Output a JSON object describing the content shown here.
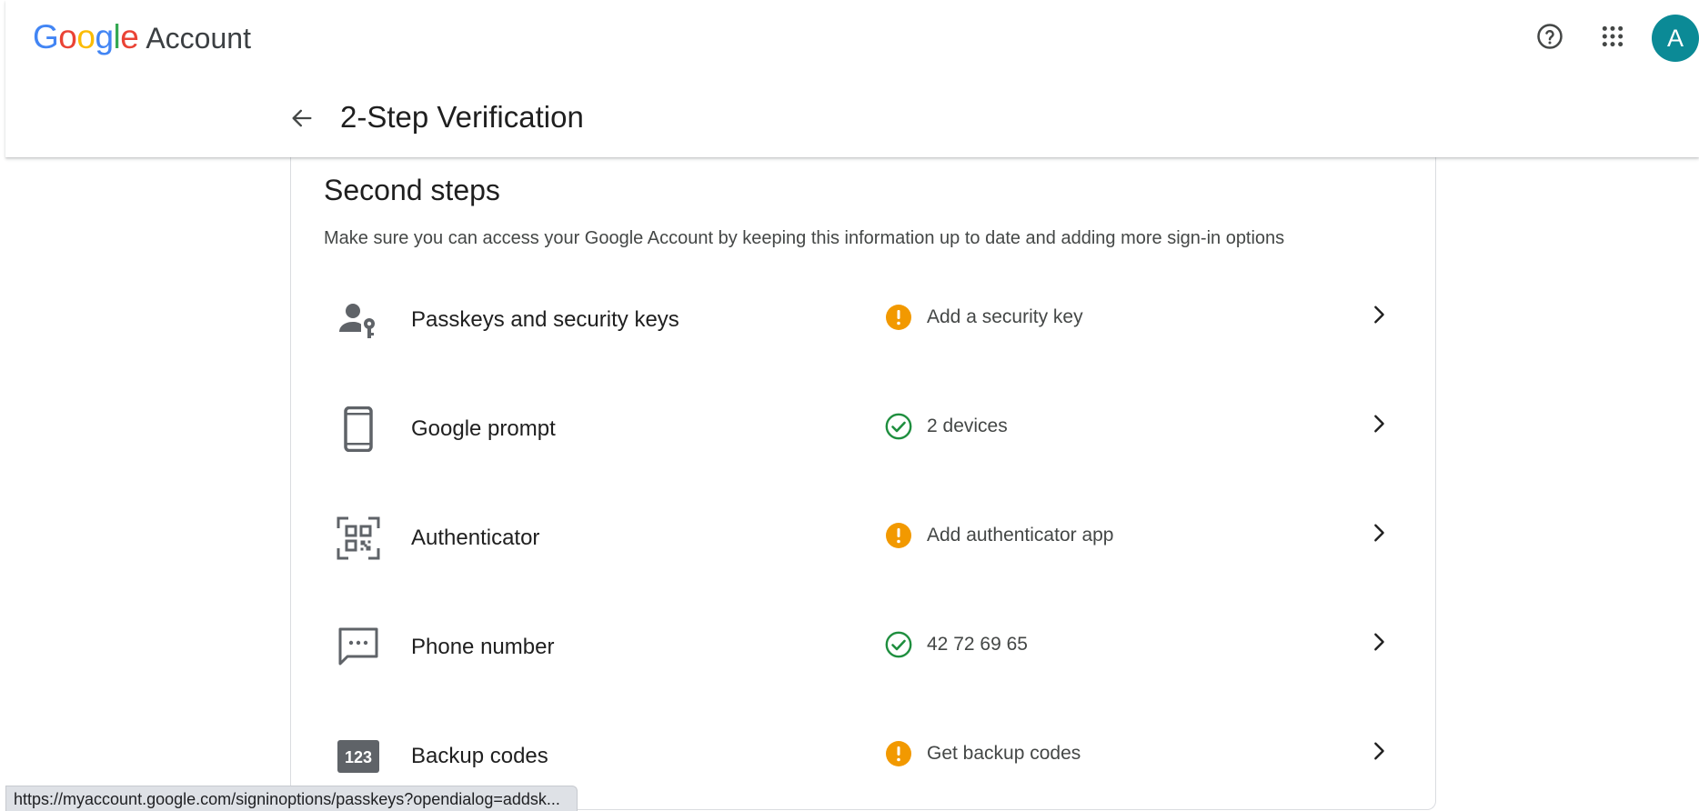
{
  "header": {
    "brand_letters": [
      "G",
      "o",
      "o",
      "g",
      "l",
      "e"
    ],
    "brand_word": "Account",
    "avatar_initial": "A",
    "help_icon": "help-circle-icon",
    "apps_icon": "apps-grid-icon"
  },
  "subbar": {
    "back_icon": "arrow-back-icon",
    "title": "2-Step Verification"
  },
  "section": {
    "title": "Second steps",
    "description": "Make sure you can access your Google Account by keeping this information up to date and adding more sign-in options"
  },
  "options": [
    {
      "label": "Passkeys and security keys",
      "status": "Add a security key",
      "status_type": "warning",
      "icon": "person-key-icon"
    },
    {
      "label": "Google prompt",
      "status": "2 devices",
      "status_type": "ok",
      "icon": "smartphone-icon"
    },
    {
      "label": "Authenticator",
      "status": "Add authenticator app",
      "status_type": "warning",
      "icon": "qr-code-scanner-icon"
    },
    {
      "label": "Phone number",
      "status": "42 72 69 65",
      "status_type": "ok",
      "icon": "sms-icon"
    },
    {
      "label": "Backup codes",
      "status": "Get backup codes",
      "status_type": "warning",
      "icon": "pin-123-icon"
    }
  ],
  "colors": {
    "warning": "#f29900",
    "ok": "#1e8e3e",
    "avatar_bg": "#0b8a96",
    "icon_grey": "#5f6368"
  },
  "status_bar": {
    "url": "https://myaccount.google.com/signinoptions/passkeys?opendialog=addsk..."
  }
}
